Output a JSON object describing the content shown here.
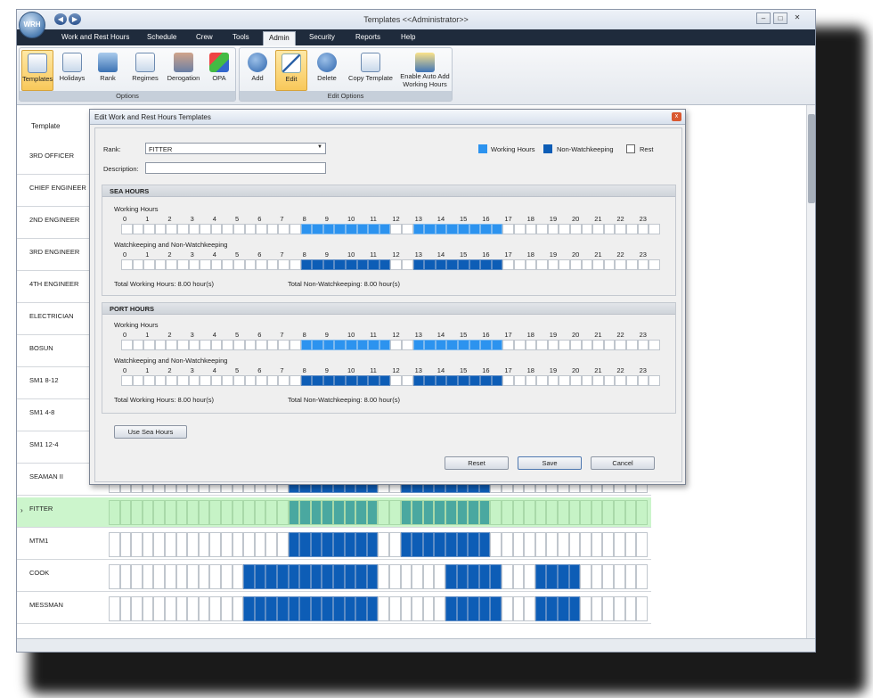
{
  "window": {
    "title": "Templates <<Administrator>>",
    "logo": "WRH"
  },
  "menu": [
    "Work and Rest Hours",
    "Schedule",
    "Crew",
    "Tools",
    "Admin",
    "Security",
    "Reports",
    "Help"
  ],
  "menu_active": "Admin",
  "ribbon": {
    "options_group": "Options",
    "edit_group": "Edit Options",
    "options_buttons": [
      {
        "label": "Templates",
        "icon": "templates-icon",
        "selected": true
      },
      {
        "label": "Holidays",
        "icon": "calendar-icon"
      },
      {
        "label": "Rank",
        "icon": "rank-chart-icon"
      },
      {
        "label": "Regimes",
        "icon": "regimes-icon"
      },
      {
        "label": "Derogation",
        "icon": "derogation-icon"
      },
      {
        "label": "OPA",
        "icon": "opa-icon"
      }
    ],
    "edit_buttons": [
      {
        "label": "Add",
        "icon": "add-icon"
      },
      {
        "label": "Edit",
        "icon": "edit-pencil-icon",
        "selected": true
      },
      {
        "label": "Delete",
        "icon": "delete-icon"
      },
      {
        "label": "Copy Template",
        "icon": "copy-template-icon"
      },
      {
        "label_1": "Enable Auto Add",
        "label_2": "Working Hours",
        "icon": "auto-add-icon"
      }
    ]
  },
  "grid": {
    "header": "Template",
    "rows": [
      "3RD OFFICER",
      "CHIEF ENGINEER",
      "2ND ENGINEER",
      "3RD ENGINEER",
      "4TH ENGINEER",
      "ELECTRICIAN",
      "BOSUN",
      "SM1 8-12",
      "SM1 4-8",
      "SM1 12-4",
      "SEAMAN II",
      "FITTER",
      "MTM1",
      "COOK",
      "MESSMAN"
    ],
    "selected_row": "FITTER",
    "row_pointer": "›",
    "visible_schedules": {
      "SEAMAN II": [
        [
          8,
          12
        ],
        [
          13,
          17
        ]
      ],
      "FITTER": [
        [
          8,
          12
        ],
        [
          13,
          17
        ]
      ],
      "MTM1": [
        [
          8,
          12
        ],
        [
          13,
          17
        ]
      ],
      "COOK": [
        [
          6,
          12
        ],
        [
          15,
          17.5
        ],
        [
          19,
          21
        ]
      ],
      "MESSMAN": [
        [
          6,
          12
        ],
        [
          15,
          17.5
        ],
        [
          19,
          21
        ]
      ]
    }
  },
  "dialog": {
    "title": "Edit Work and Rest Hours Templates",
    "rank_label": "Rank:",
    "rank_value": "FITTER",
    "description_label": "Description:",
    "description_value": "",
    "legend": {
      "working": "Working Hours",
      "non_watch": "Non-Watchkeeping",
      "rest": "Rest"
    },
    "colors": {
      "working": "#2c93ef",
      "non_watch": "#0d5db6",
      "rest": "#ffffff",
      "selected_row": "#ccf5cc"
    },
    "hours": [
      "0",
      "1",
      "2",
      "3",
      "4",
      "5",
      "6",
      "7",
      "8",
      "9",
      "10",
      "11",
      "12",
      "13",
      "14",
      "15",
      "16",
      "17",
      "18",
      "19",
      "20",
      "21",
      "22",
      "23"
    ],
    "sea": {
      "title": "SEA HOURS",
      "working_label": "Working Hours",
      "watch_label": "Watchkeeping and Non-Watchkeeping",
      "total_working": "Total Working Hours:  8.00 hour(s)",
      "total_nonwatch": "Total Non-Watchkeeping:  8.00 hour(s)",
      "working_periods": [
        [
          8,
          12
        ],
        [
          13,
          17
        ]
      ],
      "nonwatch_periods": [
        [
          8,
          12
        ],
        [
          13,
          17
        ]
      ]
    },
    "port": {
      "title": "PORT HOURS",
      "working_label": "Working Hours",
      "watch_label": "Watchkeeping and Non-Watchkeeping",
      "total_working": "Total Working Hours:  8.00 hour(s)",
      "total_nonwatch": "Total Non-Watchkeeping:  8.00 hour(s)",
      "working_periods": [
        [
          8,
          12
        ],
        [
          13,
          17
        ]
      ],
      "nonwatch_periods": [
        [
          8,
          12
        ],
        [
          13,
          17
        ]
      ]
    },
    "use_sea_button": "Use Sea Hours",
    "reset_button": "Reset",
    "save_button": "Save",
    "cancel_button": "Cancel",
    "close_glyph": "x"
  }
}
